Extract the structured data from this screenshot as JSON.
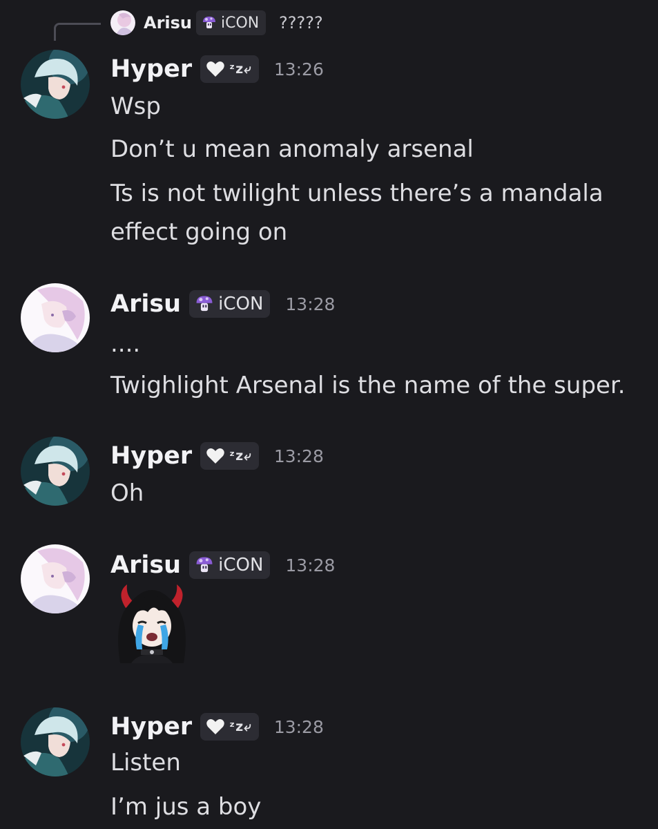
{
  "reply": {
    "author": "Arisu",
    "badge_label": "iCON",
    "text": "?????"
  },
  "messages": [
    {
      "author": "Hyper",
      "tag_label": "ᶻz⤶",
      "time": "13:26",
      "lines": [
        "Wsp",
        "Don’t u mean anomaly arsenal",
        "Ts is not twilight unless there’s a mandala",
        "effect going on"
      ]
    },
    {
      "author": "Arisu",
      "tag_label": "iCON",
      "time": "13:28",
      "lines": [
        "....",
        "Twighlight Arsenal is the name of the super."
      ]
    },
    {
      "author": "Hyper",
      "tag_label": "ᶻz⤶",
      "time": "13:28",
      "lines": [
        "Oh"
      ]
    },
    {
      "author": "Arisu",
      "tag_label": "iCON",
      "time": "13:28",
      "sticker": "crying-devil-girl-sticker"
    },
    {
      "author": "Hyper",
      "tag_label": "ᶻz⤶",
      "time": "13:28",
      "lines": [
        "Listen",
        "I’m jus a boy"
      ]
    }
  ],
  "colors": {
    "background": "#1a1a1e",
    "tag_background": "#2c2c33",
    "timestamp": "#9b9ba4",
    "mushroom_badge": "#8a5cd6"
  }
}
